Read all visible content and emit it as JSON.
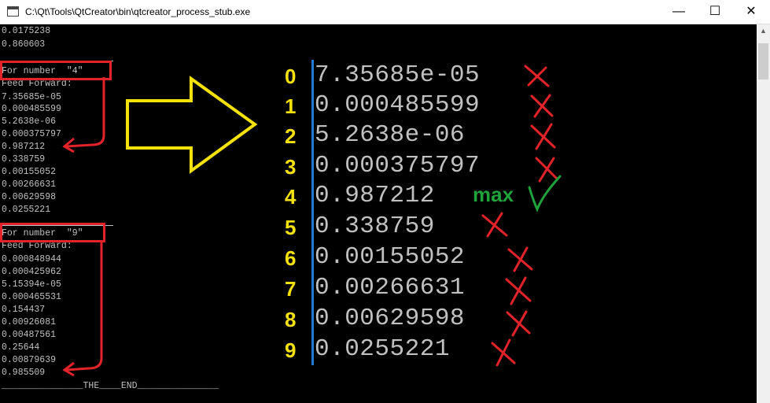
{
  "window": {
    "title": "C:\\Qt\\Tools\\QtCreator\\bin\\qtcreator_process_stub.exe",
    "minimize": "—",
    "maximize": "☐",
    "close": "✕"
  },
  "console": {
    "top_lines": [
      "0.0175238",
      "0.860603"
    ],
    "block4": {
      "header": "For number  \"4\"",
      "feed": "Feed Forward:",
      "values": [
        "7.35685e-05",
        "0.000485599",
        "5.2638e-06",
        "0.000375797",
        "0.987212",
        "0.338759",
        "0.00155052",
        "0.00266631",
        "0.00629598",
        "0.0255221"
      ]
    },
    "block9": {
      "header": "For number  \"9\"",
      "feed": "Feed Forward:",
      "values": [
        "0.000848944",
        "0.000425962",
        "5.15394e-05",
        "0.000465531",
        "0.154437",
        "0.00926081",
        "0.00487561",
        "0.25644",
        "0.00879639",
        "0.985509"
      ]
    },
    "end_line": "_______________THE____END_______________"
  },
  "annotation": {
    "indices": [
      "0",
      "1",
      "2",
      "3",
      "4",
      "5",
      "6",
      "7",
      "8",
      "9"
    ],
    "values": [
      "7.35685e-05",
      "0.000485599",
      "5.2638e-06",
      "0.000375797",
      "0.987212",
      "0.338759",
      "0.00155052",
      "0.00266631",
      "0.00629598",
      "0.0255221"
    ],
    "max_label": "max",
    "colors": {
      "red": "#e3232a",
      "yellow": "#f5e10a",
      "green": "#1ea43b",
      "blue": "#1f7bd6"
    }
  }
}
